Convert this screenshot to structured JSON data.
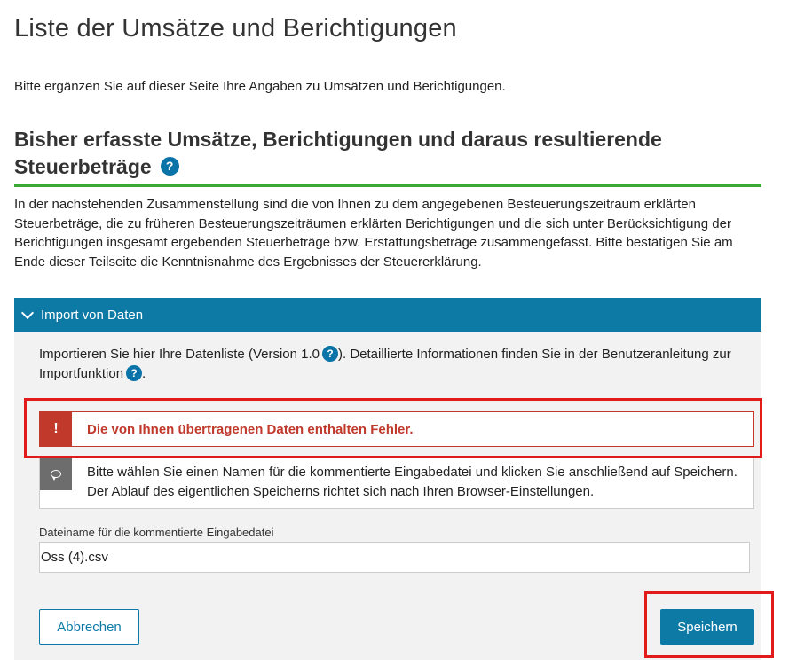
{
  "page": {
    "title": "Liste der Umsätze und Berichtigungen",
    "intro": "Bitte ergänzen Sie auf dieser Seite Ihre Angaben zu Umsätzen und Berichtigungen."
  },
  "section": {
    "title": "Bisher erfasste Umsätze, Berichtigungen und daraus resultierende Steuerbeträge",
    "help_icon": "?",
    "description": "In der nachstehenden Zusammenstellung sind die von Ihnen zu dem angegebenen Besteuerungszeitraum erklärten Steuerbeträge, die zu früheren Besteuerungszeiträumen erklärten Berichtigungen und die sich unter Berücksichtigung der Berichtigungen insgesamt ergebenden Steuerbeträge bzw. Erstattungsbeträge zusammengefasst. Bitte bestätigen Sie am Ende dieser Teilseite die Kenntnisnahme des Ergebnisses der Steuererklärung."
  },
  "import": {
    "header": "Import von Daten",
    "text_part1": "Importieren Sie hier Ihre Datenliste (Version 1.0",
    "text_part2": "). Detaillierte Informationen finden Sie in der Benutzeranleitung zur Importfunktion",
    "text_part3": ".",
    "error_icon": "!",
    "error_message": "Die von Ihnen übertragenen Daten enthalten Fehler.",
    "info_message": "Bitte wählen Sie einen Namen für die kommentierte Eingabedatei und klicken Sie anschließend auf Speichern. Der Ablauf des eigentlichen Speicherns richtet sich nach Ihren Browser-Einstellungen.",
    "field_label": "Dateiname für die kommentierte Eingabedatei",
    "field_value": "Oss (4).csv",
    "cancel_label": "Abbrechen",
    "save_label": "Speichern"
  },
  "colors": {
    "accent": "#0d7aa6",
    "green_rule": "#3aaa35",
    "error": "#c0392b",
    "highlight": "#e11a1a",
    "panel_bg": "#f2f2f2"
  },
  "icons": {
    "help": "help-icon",
    "chevron": "chevron-down-icon",
    "error": "exclamation-icon",
    "info": "speech-bubble-icon"
  }
}
